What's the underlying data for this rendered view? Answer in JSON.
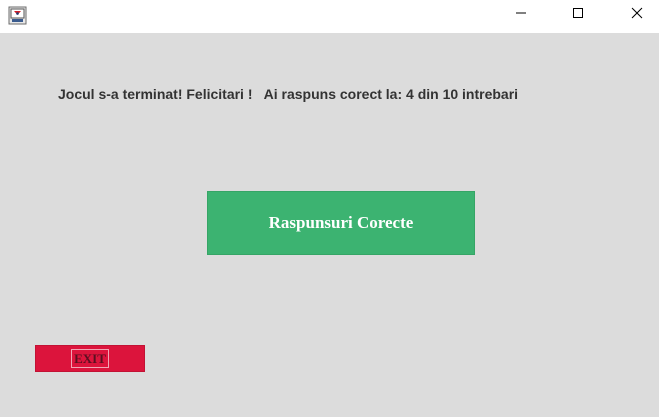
{
  "window": {
    "icon": "java-app-icon",
    "controls": {
      "minimize_icon": "minimize-icon",
      "maximize_icon": "maximize-icon",
      "close_icon": "close-icon"
    }
  },
  "main": {
    "result_message": "Jocul s-a terminat! Felicitari !   Ai raspuns corect la: 4 din 10 intrebari",
    "answers_button_label": "Raspunsuri Corecte",
    "exit_button_label": "EXIT"
  },
  "colors": {
    "background": "#dcdcdc",
    "answers_button": "#3cb371",
    "exit_button": "#dc143c"
  }
}
